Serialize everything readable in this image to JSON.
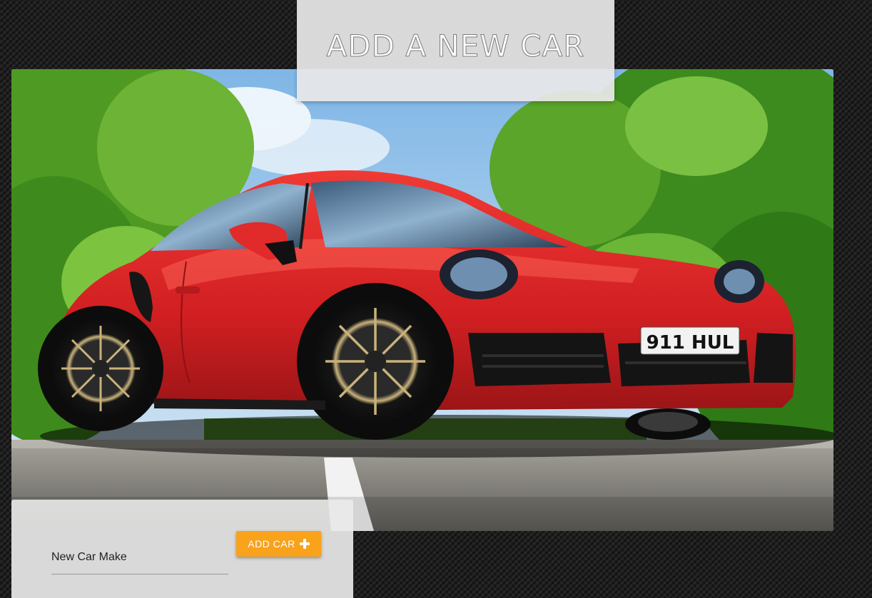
{
  "header": {
    "title": "ADD A NEW CAR"
  },
  "hero": {
    "subject": "red sports car on road",
    "plate_text": "911 HUL"
  },
  "form": {
    "make_field_label": "New Car Make",
    "add_button_label": "ADD CAR",
    "add_button_icon": "plus-icon"
  },
  "colors": {
    "accent": "#f9a21c",
    "car_body": "#e0262a",
    "panel": "#d9d9d9"
  }
}
